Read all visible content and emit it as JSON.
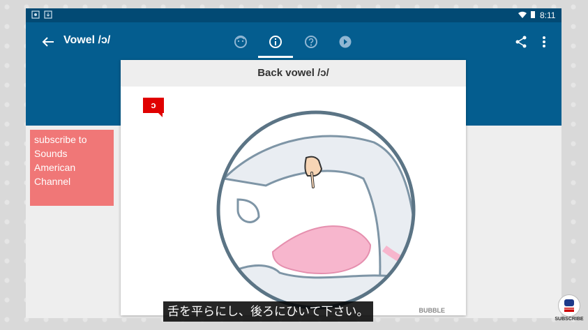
{
  "app": {
    "title": "Vowel /ɔ/",
    "status_time": "8:11",
    "tabs": [
      "face-tab-icon",
      "info-tab-icon",
      "help-tab-icon",
      "play-tab-icon"
    ],
    "selected_tab": 1
  },
  "card": {
    "header": "Back vowel /ɔ/",
    "badge": "ɔ",
    "credit": "BUBBLE"
  },
  "overlay": {
    "subscribe_lines": [
      "subscribe to",
      "Sounds",
      "American",
      "Channel"
    ],
    "caption": "舌を平らにし、後ろにひいて下さい。",
    "subscribe_logo_label": "SUBSCRIBE"
  },
  "colors": {
    "status_bar": "#024a74",
    "app_bar": "#045d8f",
    "badge": "#e00000",
    "subscribe_box": "#f07777",
    "tongue": "#f7b6cd"
  }
}
